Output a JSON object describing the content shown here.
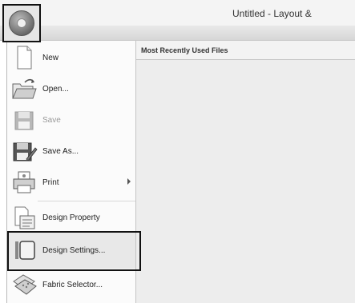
{
  "window": {
    "title": "Untitled - Layout &"
  },
  "menu": {
    "items": [
      {
        "label": "New"
      },
      {
        "label": "Open..."
      },
      {
        "label": "Save"
      },
      {
        "label": "Save As..."
      },
      {
        "label": "Print"
      },
      {
        "label": "Design Property"
      },
      {
        "label": "Design Settings..."
      },
      {
        "label": "Fabric Selector..."
      }
    ],
    "recent_files_title": "Most Recently Used Files"
  }
}
